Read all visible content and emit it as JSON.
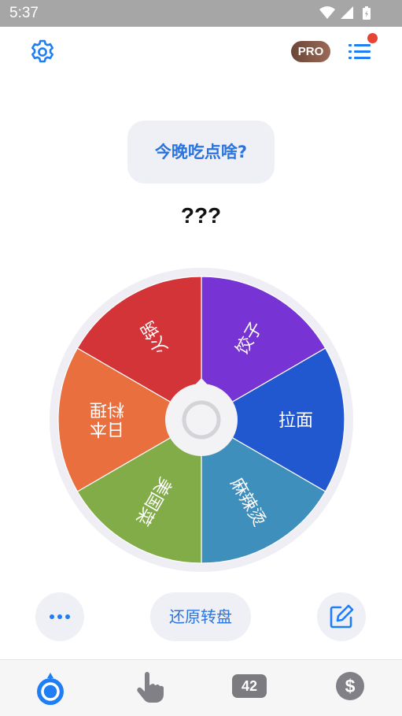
{
  "status_bar": {
    "time": "5:37"
  },
  "header": {
    "pro_label": "PRO"
  },
  "question": "今晚吃点啥?",
  "result": "???",
  "wheel": {
    "segments": [
      {
        "label": "饺子",
        "color": "#7733d4"
      },
      {
        "label": "拉面",
        "color": "#2258cf"
      },
      {
        "label": "麻辣烫",
        "color": "#3f8fbd"
      },
      {
        "label": "美国菜",
        "color": "#82ac48"
      },
      {
        "label": "日本料理",
        "color": "#e96f3e"
      },
      {
        "label": "火锅",
        "color": "#d33438"
      }
    ]
  },
  "actions": {
    "reset_label": "还原转盘"
  },
  "tabbar": {
    "counter": "42"
  },
  "colors": {
    "accent": "#1f7ef4",
    "question_text": "#2a74e0",
    "notification_dot": "#e84435"
  }
}
